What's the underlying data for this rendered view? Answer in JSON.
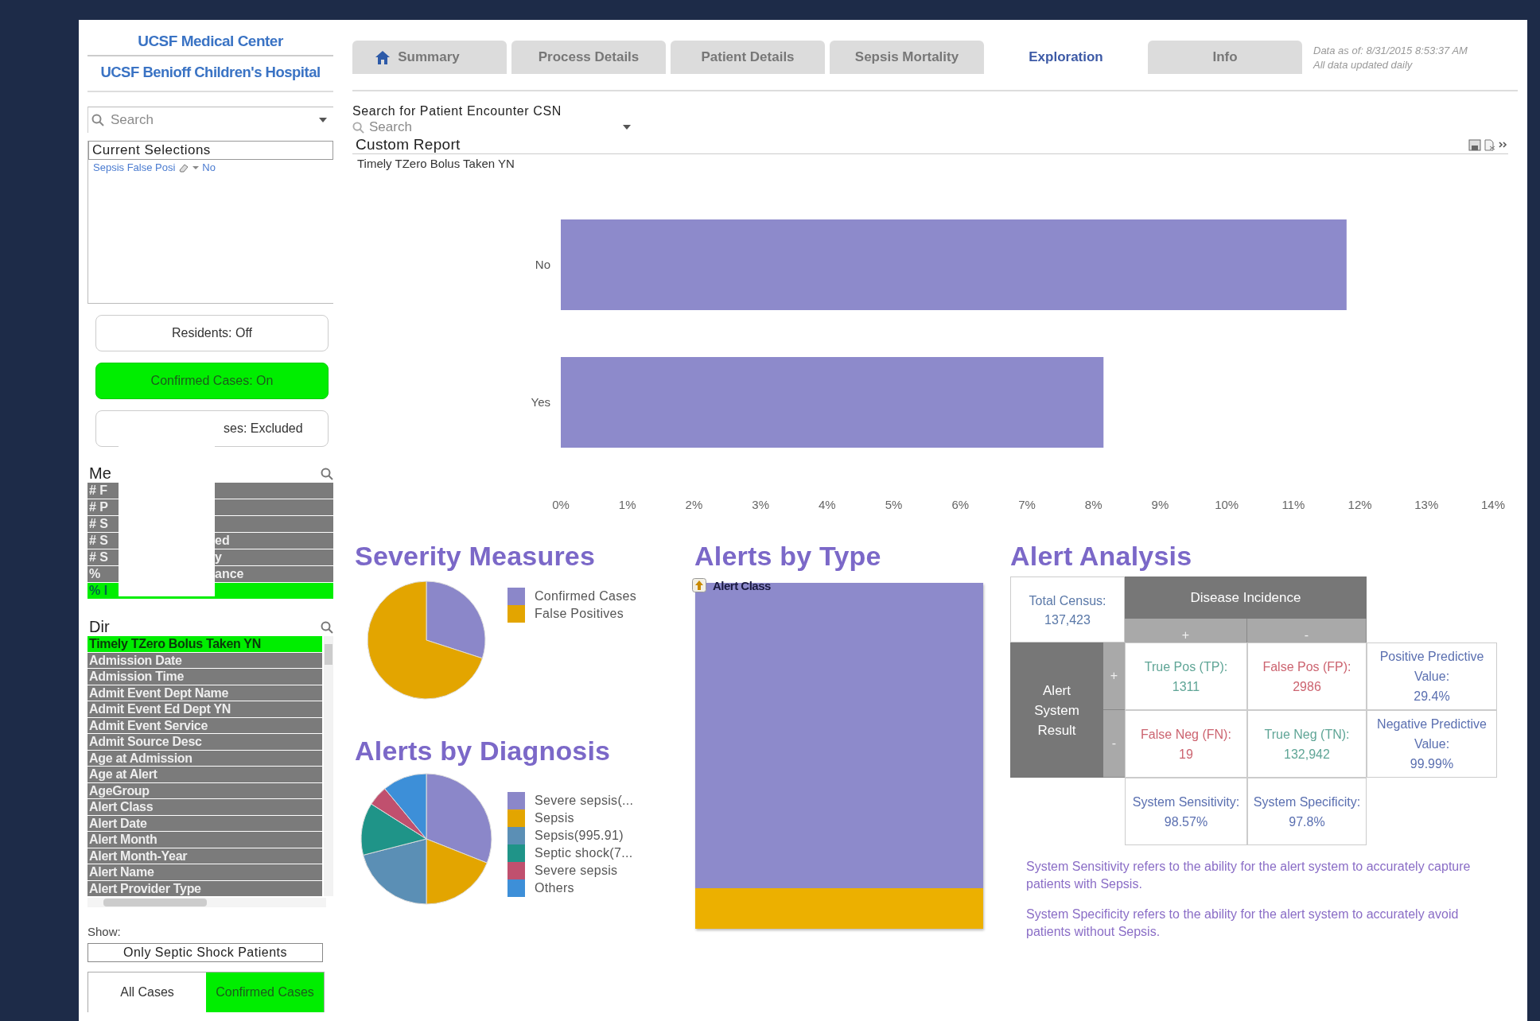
{
  "sidebar": {
    "logos": [
      "UCSF Medical Center",
      "UCSF Benioff Children's Hospital"
    ],
    "search": {
      "placeholder": "Search"
    },
    "current_selections": {
      "title": "Current Selections",
      "items": [
        {
          "field": "Sepsis False Posi",
          "value": "No"
        }
      ]
    },
    "toggles": [
      {
        "label": "Residents: Off",
        "on": false
      },
      {
        "label": "Confirmed Cases: On",
        "on": true
      },
      {
        "label": "ses: Excluded",
        "on": false
      }
    ],
    "measures": {
      "title": "Me",
      "rows": [
        {
          "left": "# F",
          "right": "",
          "selected": false
        },
        {
          "left": "# P",
          "right": "",
          "selected": false
        },
        {
          "left": "# S",
          "right": "",
          "selected": false
        },
        {
          "left": "# S",
          "right": "ed",
          "selected": false
        },
        {
          "left": "# S",
          "right": "y",
          "selected": false
        },
        {
          "left": "%",
          "right": "ance",
          "selected": false
        },
        {
          "left": "% I",
          "right": "",
          "selected": true
        }
      ]
    },
    "dimensions": {
      "title": "Dir",
      "items": [
        {
          "label": "Timely TZero Bolus Taken YN",
          "selected": true
        },
        {
          "label": "Admission Date",
          "selected": false
        },
        {
          "label": "Admission Time",
          "selected": false
        },
        {
          "label": "Admit Event Dept Name",
          "selected": false
        },
        {
          "label": "Admit Event Ed Dept YN",
          "selected": false
        },
        {
          "label": "Admit Event Service",
          "selected": false
        },
        {
          "label": "Admit Source Desc",
          "selected": false
        },
        {
          "label": "Age at Admission",
          "selected": false
        },
        {
          "label": "Age at Alert",
          "selected": false
        },
        {
          "label": "AgeGroup",
          "selected": false
        },
        {
          "label": "Alert Class",
          "selected": false
        },
        {
          "label": "Alert Date",
          "selected": false
        },
        {
          "label": "Alert Month",
          "selected": false
        },
        {
          "label": "Alert Month-Year",
          "selected": false
        },
        {
          "label": "Alert Name",
          "selected": false
        },
        {
          "label": "Alert Provider Type",
          "selected": false
        }
      ]
    },
    "show": {
      "label": "Show:",
      "option": "Only Septic Shock Patients",
      "choices": [
        {
          "label": "All Cases",
          "selected": false
        },
        {
          "label": "Confirmed Cases",
          "selected": true
        }
      ]
    }
  },
  "tabs": [
    {
      "label": "Summary",
      "selected": false
    },
    {
      "label": "Process Details",
      "selected": false
    },
    {
      "label": "Patient Details",
      "selected": false
    },
    {
      "label": "Sepsis Mortality",
      "selected": false
    },
    {
      "label": "Exploration",
      "selected": true
    },
    {
      "label": "Info",
      "selected": false
    }
  ],
  "data_note": [
    "Data as of: 8/31/2015 8:53:37 AM",
    "All data updated daily"
  ],
  "encounter_search": {
    "label": "Search for Patient Encounter CSN",
    "placeholder": "Search"
  },
  "custom_report": {
    "title": "Custom Report",
    "subtitle": "Timely TZero Bolus Taken YN",
    "chart_data": {
      "type": "bar",
      "orientation": "horizontal",
      "categories": [
        "No",
        "Yes"
      ],
      "series": [
        {
          "color": "#8d8acb",
          "values": [
            11.8,
            8.15
          ]
        }
      ],
      "xlim": [
        0,
        14
      ],
      "xticks": [
        {
          "value": 0,
          "label": "0%"
        },
        {
          "value": 1,
          "label": "1%"
        },
        {
          "value": 2,
          "label": "2%"
        },
        {
          "value": 3,
          "label": "3%"
        },
        {
          "value": 4,
          "label": "4%"
        },
        {
          "value": 5,
          "label": "5%"
        },
        {
          "value": 6,
          "label": "6%"
        },
        {
          "value": 7,
          "label": "7%"
        },
        {
          "value": 8,
          "label": "8%"
        },
        {
          "value": 9,
          "label": "9%"
        },
        {
          "value": 10,
          "label": "10%"
        },
        {
          "value": 11,
          "label": "11%"
        },
        {
          "value": 12,
          "label": "12%"
        },
        {
          "value": 13,
          "label": "13%"
        },
        {
          "value": 14,
          "label": "14%"
        }
      ]
    }
  },
  "severity": {
    "title": "Severity Measures",
    "legend": [
      {
        "label": "Confirmed Cases",
        "color": "#8b87c9"
      },
      {
        "label": "False Positives",
        "color": "#e3a500"
      }
    ]
  },
  "diagnosis": {
    "title": "Alerts by Diagnosis",
    "legend": [
      {
        "label": "Severe sepsis(...",
        "color": "#8b87c9"
      },
      {
        "label": "Sepsis",
        "color": "#e3a500"
      },
      {
        "label": "Sepsis(995.91)",
        "color": "#5b8fb5"
      },
      {
        "label": "Septic shock(7...",
        "color": "#1f9488"
      },
      {
        "label": "Severe sepsis",
        "color": "#c0506e"
      },
      {
        "label": "Others",
        "color": "#3d8fd8"
      }
    ]
  },
  "alert_type": {
    "title": "Alerts by Type",
    "dimension": "Alert Class"
  },
  "alert_analysis": {
    "title": "Alert Analysis",
    "total_census": {
      "label": "Total Census:",
      "value": "137,423"
    },
    "column_header": "Disease Incidence",
    "column_signs": [
      "+",
      "-"
    ],
    "row_header": "Alert System Result",
    "row_signs": [
      "+",
      "-"
    ],
    "cells": [
      [
        {
          "kind": "true",
          "label": "True Pos (TP):",
          "value": "1311"
        },
        {
          "kind": "false",
          "label": "False Pos (FP):",
          "value": "2986"
        },
        {
          "kind": "summary",
          "label": "Positive Predictive Value:",
          "value": "29.4%"
        }
      ],
      [
        {
          "kind": "false",
          "label": "False Neg (FN):",
          "value": "19"
        },
        {
          "kind": "true",
          "label": "True Neg (TN):",
          "value": "132,942"
        },
        {
          "kind": "summary",
          "label": "Negative Predictive Value:",
          "value": "99.99%"
        }
      ]
    ],
    "footer": [
      {
        "label": "System Sensitivity:",
        "value": "98.57%"
      },
      {
        "label": "System Specificity:",
        "value": "97.8%"
      }
    ],
    "notes": [
      "System Sensitivity refers to the ability for the alert system to accurately capture patients with Sepsis.",
      "System Specificity refers to the ability for the alert system to accurately avoid patients without Sepsis."
    ]
  }
}
